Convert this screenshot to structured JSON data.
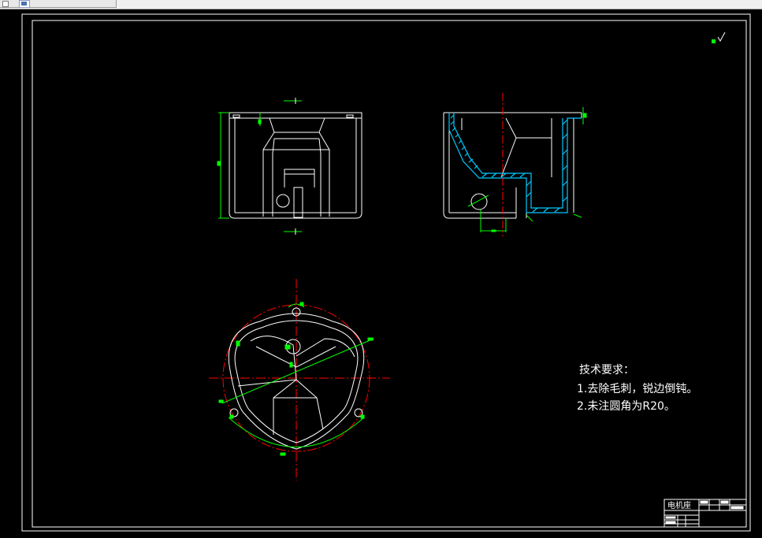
{
  "window": {
    "doc_tab_label": ""
  },
  "drawing": {
    "notes": {
      "title": "技术要求：",
      "items": [
        "1.去除毛刺，锐边倒钝。",
        "2.未注圆角为R20。"
      ]
    },
    "title_block": {
      "part_name": "电机座"
    }
  },
  "colors": {
    "background": "#000000",
    "outline": "#ffffff",
    "dimension": "#00ff00",
    "centerline": "#ff0000",
    "hatch": "#00c8ff"
  },
  "icons": {
    "doc": "document-icon",
    "roughness": "surface-roughness-icon"
  }
}
